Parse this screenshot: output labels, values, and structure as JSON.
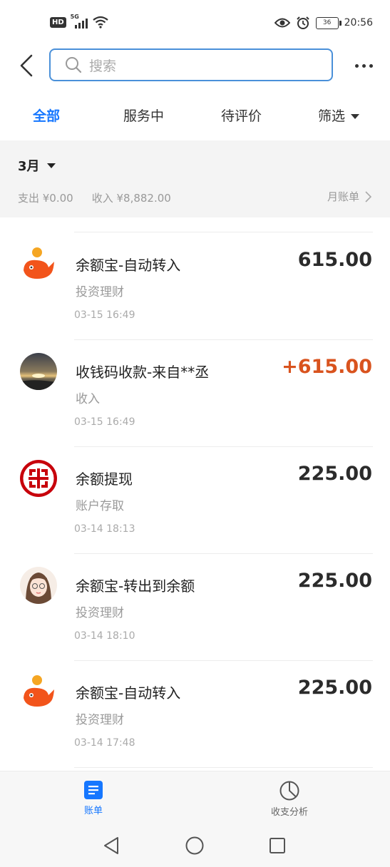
{
  "status_bar": {
    "hd_label": "HD",
    "network_label": "5G",
    "battery_level": "36",
    "time": "20:56"
  },
  "search": {
    "placeholder": "搜索"
  },
  "tabs": [
    {
      "label": "全部",
      "active": true
    },
    {
      "label": "服务中",
      "active": false
    },
    {
      "label": "待评价",
      "active": false
    },
    {
      "label": "筛选",
      "active": false
    }
  ],
  "month_section": {
    "month": "3月",
    "expense": "支出 ¥0.00",
    "income": "收入 ¥8,882.00",
    "monthly_bill_link": "月账单"
  },
  "transactions": [
    {
      "title": "余额宝-自动转入",
      "category": "投资理财",
      "time": "03-15  16:49",
      "amount": "615.00",
      "icon": "yuebao-icon",
      "is_income": false
    },
    {
      "title": "收钱码收款-来自**丞",
      "category": "收入",
      "time": "03-15  16:49",
      "amount": "+615.00",
      "icon": "sunset-avatar",
      "is_income": true
    },
    {
      "title": "余额提现",
      "category": "账户存取",
      "time": "03-14  18:13",
      "amount": "225.00",
      "icon": "icbc-logo-icon",
      "is_income": false
    },
    {
      "title": "余额宝-转出到余额",
      "category": "投资理财",
      "time": "03-14  18:10",
      "amount": "225.00",
      "icon": "girl-avatar",
      "is_income": false
    },
    {
      "title": "余额宝-自动转入",
      "category": "投资理财",
      "time": "03-14  17:48",
      "amount": "225.00",
      "icon": "yuebao-icon",
      "is_income": false
    }
  ],
  "bottom_tabs": [
    {
      "label": "账单",
      "icon": "bill-icon",
      "active": true
    },
    {
      "label": "收支分析",
      "icon": "pie-chart-icon",
      "active": false
    }
  ],
  "colors": {
    "accent": "#1677ff",
    "income": "#d9531e",
    "yuebao_orange": "#f2541b",
    "icbc_red": "#c7000b"
  }
}
